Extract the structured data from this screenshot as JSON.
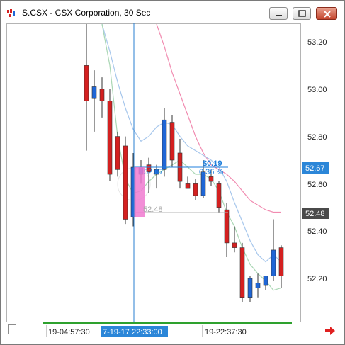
{
  "window": {
    "title": "S.CSX - CSX Corporation, 30 Sec",
    "colors": {
      "up": "#1f66d6",
      "down": "#d42020",
      "ma_fast": "#aad7b4",
      "ma_mid": "#a7c7ec",
      "ma_slow": "#f18bb0",
      "crosshair": "#2a7fd0",
      "highlight": "#f07ad0"
    }
  },
  "price_axis": {
    "ticks": [
      "53.20",
      "53.00",
      "52.80",
      "52.60",
      "52.40",
      "52.20"
    ],
    "current_tag": "52.67",
    "level_tag": "52.48"
  },
  "time_axis": {
    "labels": [
      "19-04:57:30",
      "7-19-17 22:33:00",
      "19-22:37:30"
    ]
  },
  "measure": {
    "change": "$0.19",
    "percent": "0.36 %",
    "start_price": "52.67",
    "end_price": "52.48"
  },
  "chart_data": {
    "type": "candlestick",
    "title": "S.CSX - CSX Corporation, 30 Sec",
    "ylim": [
      52.06,
      53.3
    ],
    "yticks": [
      53.2,
      53.0,
      52.8,
      52.6,
      52.4,
      52.2
    ],
    "series": [
      {
        "o": 53.1,
        "h": 53.3,
        "l": 52.74,
        "c": 52.95
      },
      {
        "o": 52.96,
        "h": 53.08,
        "l": 52.82,
        "c": 53.01
      },
      {
        "o": 53.0,
        "h": 53.05,
        "l": 52.88,
        "c": 52.95
      },
      {
        "o": 52.95,
        "h": 53.0,
        "l": 52.61,
        "c": 52.64
      },
      {
        "o": 52.8,
        "h": 52.82,
        "l": 52.63,
        "c": 52.66
      },
      {
        "o": 52.76,
        "h": 52.8,
        "l": 52.43,
        "c": 52.45
      },
      {
        "o": 52.46,
        "h": 52.73,
        "l": 52.42,
        "c": 52.67
      },
      {
        "o": 52.64,
        "h": 52.7,
        "l": 52.6,
        "c": 52.67
      },
      {
        "o": 52.68,
        "h": 52.71,
        "l": 52.56,
        "c": 52.65
      },
      {
        "o": 52.64,
        "h": 52.68,
        "l": 52.58,
        "c": 52.66
      },
      {
        "o": 52.66,
        "h": 52.92,
        "l": 52.63,
        "c": 52.87
      },
      {
        "o": 52.86,
        "h": 52.89,
        "l": 52.67,
        "c": 52.7
      },
      {
        "o": 52.73,
        "h": 52.79,
        "l": 52.58,
        "c": 52.61
      },
      {
        "o": 52.6,
        "h": 52.63,
        "l": 52.58,
        "c": 52.58
      },
      {
        "o": 52.6,
        "h": 52.62,
        "l": 52.53,
        "c": 52.55
      },
      {
        "o": 52.55,
        "h": 52.7,
        "l": 52.54,
        "c": 52.65
      },
      {
        "o": 52.63,
        "h": 52.66,
        "l": 52.59,
        "c": 52.61
      },
      {
        "o": 52.6,
        "h": 52.61,
        "l": 52.48,
        "c": 52.5
      },
      {
        "o": 52.49,
        "h": 52.52,
        "l": 52.29,
        "c": 52.35
      },
      {
        "o": 52.35,
        "h": 52.42,
        "l": 52.31,
        "c": 52.33
      },
      {
        "o": 52.33,
        "h": 52.35,
        "l": 52.1,
        "c": 52.12
      },
      {
        "o": 52.12,
        "h": 52.21,
        "l": 52.1,
        "c": 52.2
      },
      {
        "o": 52.16,
        "h": 52.22,
        "l": 52.12,
        "c": 52.18
      },
      {
        "o": 52.17,
        "h": 52.21,
        "l": 52.15,
        "c": 52.21
      },
      {
        "o": 52.21,
        "h": 52.45,
        "l": 52.19,
        "c": 52.32
      },
      {
        "o": 52.33,
        "h": 52.34,
        "l": 52.16,
        "c": 52.21
      }
    ],
    "ma_fast": [
      null,
      null,
      53.3,
      53.1,
      52.8,
      52.62,
      52.56,
      52.57,
      52.61,
      52.64,
      52.66,
      52.68,
      52.7,
      52.67,
      52.64,
      52.64,
      52.62,
      52.57,
      52.48,
      52.42,
      52.33,
      52.26,
      52.22,
      52.19,
      52.15,
      52.16
    ],
    "ma_mid": [
      null,
      null,
      53.3,
      53.16,
      53.03,
      52.92,
      52.83,
      52.78,
      52.8,
      52.84,
      52.86,
      52.85,
      52.8,
      52.76,
      52.74,
      52.72,
      52.7,
      52.67,
      52.61,
      52.52,
      52.44,
      52.36,
      52.3,
      52.27,
      52.3,
      52.27
    ],
    "ma_slow": [
      null,
      null,
      null,
      null,
      null,
      null,
      null,
      null,
      null,
      53.3,
      53.18,
      53.07,
      52.98,
      52.89,
      52.8,
      52.73,
      52.68,
      52.66,
      52.64,
      52.61,
      52.57,
      52.53,
      52.51,
      52.49,
      52.48,
      52.48
    ]
  }
}
